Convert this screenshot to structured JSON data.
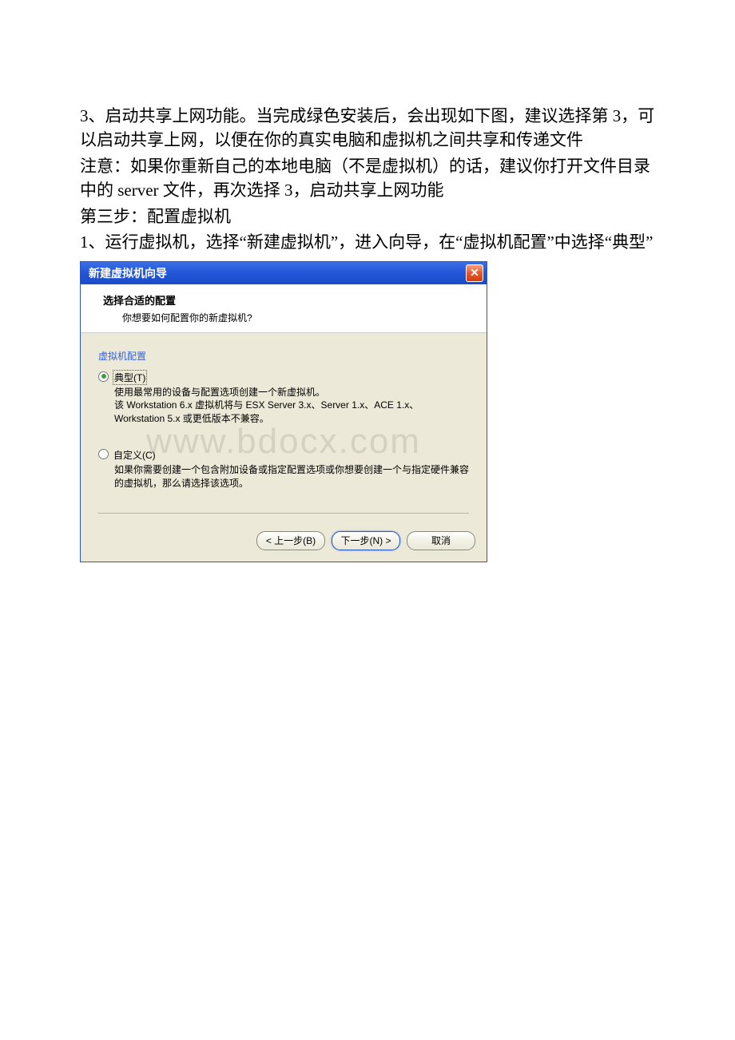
{
  "doc": {
    "p1": "3、启动共享上网功能。当完成绿色安装后，会出现如下图，建议选择第 3，可以启动共享上网，以便在你的真实电脑和虚拟机之间共享和传递文件",
    "p2": "注意：如果你重新自己的本地电脑（不是虚拟机）的话，建议你打开文件目录中的 server 文件，再次选择 3，启动共享上网功能",
    "p3": "第三步：配置虚拟机",
    "p4": "1、运行虚拟机，选择“新建虚拟机”，进入向导，在“虚拟机配置”中选择“典型”"
  },
  "dialog": {
    "title": "新建虚拟机向导",
    "header_title": "选择合适的配置",
    "header_sub": "你想要如何配置你的新虚拟机?",
    "group_label": "虚拟机配置",
    "option1_label": "典型(T)",
    "option1_desc": "使用最常用的设备与配置选项创建一个新虚拟机。\n该 Workstation 6.x 虚拟机将与 ESX Server 3.x、Server 1.x、ACE 1.x、Workstation 5.x 或更低版本不兼容。",
    "option2_label": "自定义(C)",
    "option2_desc": "如果你需要创建一个包含附加设备或指定配置选项或你想要创建一个与指定硬件兼容的虚拟机，那么请选择该选项。",
    "btn_back": "< 上一步(B)",
    "btn_next": "下一步(N) >",
    "btn_cancel": "取消",
    "close_x": "✕"
  },
  "watermark": "www.bdocx.com"
}
